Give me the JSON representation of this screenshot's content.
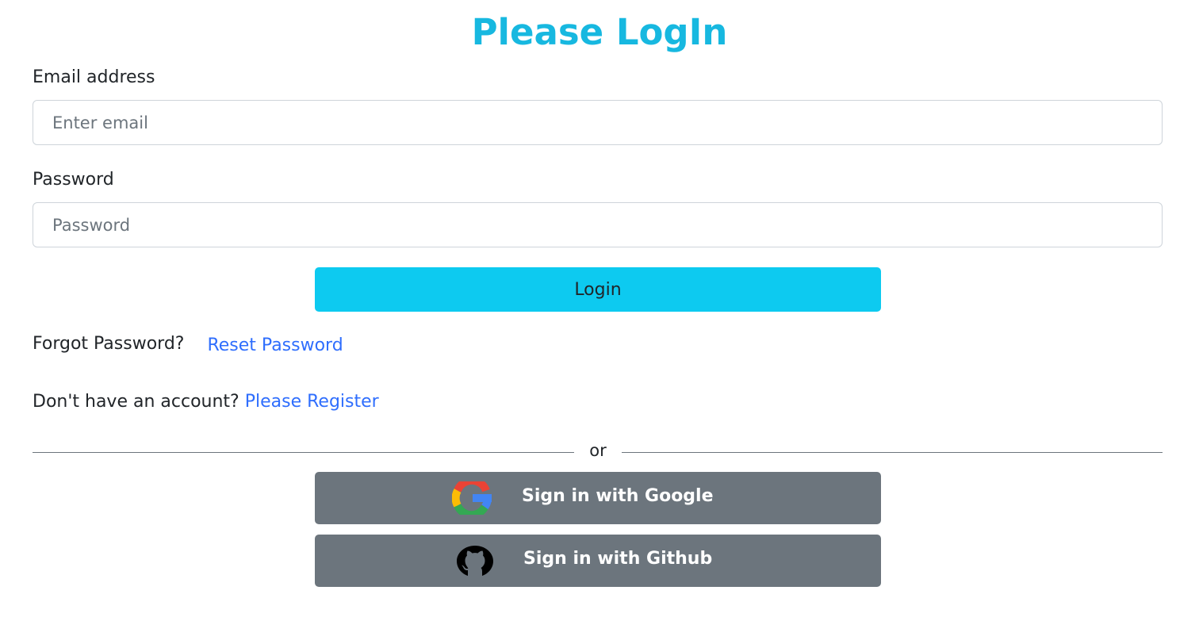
{
  "header": {
    "title": "Please LogIn"
  },
  "form": {
    "email_label": "Email address",
    "email_placeholder": "Enter email",
    "email_value": "",
    "password_label": "Password",
    "password_placeholder": "Password",
    "password_value": "",
    "login_label": "Login"
  },
  "help": {
    "forgot_text": "Forgot Password?",
    "reset_link": "Reset Password",
    "no_account_text": "Don't have an account?",
    "register_link": "Please Register"
  },
  "divider": {
    "text": "or"
  },
  "social": {
    "google_label": "Sign in with Google",
    "google_icon": "google-icon",
    "github_label": "Sign in with Github",
    "github_icon": "github-icon"
  },
  "colors": {
    "title": "#17b8e0",
    "login_button": "#0dcaf0",
    "link": "#2f6efd",
    "social_button": "#6c757d",
    "input_border": "#ced4da"
  }
}
